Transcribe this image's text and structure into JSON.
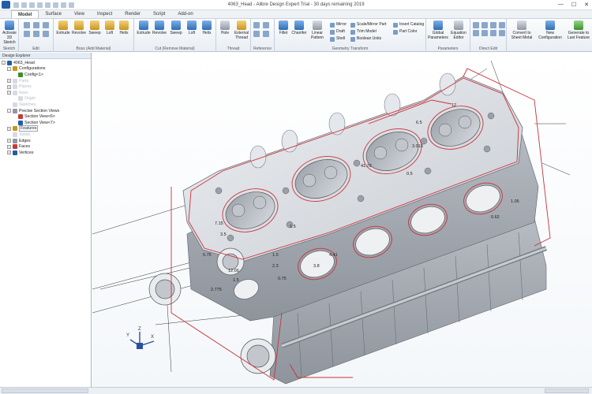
{
  "window": {
    "title": "4063_Head - Alibre Design Expert Trial - 30 days remaining 2019"
  },
  "tabs": [
    "Model",
    "Surface",
    "View",
    "Inspect",
    "Render",
    "Script",
    "Add-on"
  ],
  "ribbon": {
    "sketch": {
      "tool": "Activate 3D Sketch",
      "group": "Sketch"
    },
    "edit": {
      "group": "Edit"
    },
    "boss": {
      "group": "Boss (Add Material)",
      "tools": [
        "Extrude",
        "Revolve",
        "Sweep",
        "Loft",
        "Helix"
      ]
    },
    "cut": {
      "group": "Cut (Remove Material)",
      "tools": [
        "Extrude",
        "Revolve",
        "Sweep",
        "Loft",
        "Helix"
      ]
    },
    "thread": {
      "group": "Thread",
      "tools": [
        "Hole",
        "External Thread"
      ]
    },
    "reference": {
      "group": "Reference"
    },
    "geometry": {
      "group": "Geometry Transform",
      "tools": [
        "Fillet",
        "Chamfer",
        "Linear Pattern"
      ],
      "list1": [
        "Mirror",
        "Draft",
        "Shell"
      ],
      "list2": [
        "Scale/Mirror Part",
        "Trim Model",
        "Boolean Units"
      ],
      "list3": [
        "Insert Catalog",
        "Part Color"
      ]
    },
    "parameters": {
      "group": "Parameters",
      "tools": [
        "Global Parameters",
        "Equation Editor"
      ]
    },
    "direct_edit": {
      "group": "Direct Edit"
    },
    "other": {
      "tools": [
        "Convert to Sheet Metal",
        "New Configuration",
        "Generate to Last Feature"
      ]
    }
  },
  "explorer": {
    "title": "Design Explorer",
    "items": [
      {
        "label": "4063_Head",
        "level": 0,
        "expander": "-",
        "dim": false
      },
      {
        "label": "Configurations",
        "level": 1,
        "expander": "-",
        "dim": false
      },
      {
        "label": "Config<1>",
        "level": 2,
        "expander": "",
        "dim": false
      },
      {
        "label": "Parts",
        "level": 1,
        "expander": "+",
        "dim": true
      },
      {
        "label": "Planes",
        "level": 1,
        "expander": "+",
        "dim": true
      },
      {
        "label": "Axes",
        "level": 1,
        "expander": "+",
        "dim": true
      },
      {
        "label": "Origin",
        "level": 2,
        "expander": "",
        "dim": true
      },
      {
        "label": "Sketches",
        "level": 1,
        "expander": "",
        "dim": true
      },
      {
        "label": "Precise Section Views",
        "level": 1,
        "expander": "-",
        "dim": false
      },
      {
        "label": "Section View<6>",
        "level": 2,
        "expander": "",
        "dim": false
      },
      {
        "label": "Section View<7>",
        "level": 2,
        "expander": "",
        "dim": false
      },
      {
        "label": "Features",
        "level": 1,
        "expander": "+",
        "dim": false,
        "selected": true
      },
      {
        "label": "Solids",
        "level": 1,
        "expander": "",
        "dim": true
      },
      {
        "label": "Edges",
        "level": 1,
        "expander": "+",
        "dim": false
      },
      {
        "label": "Faces",
        "level": 1,
        "expander": "+",
        "dim": false
      },
      {
        "label": "Vertices",
        "level": 1,
        "expander": "+",
        "dim": false
      }
    ]
  },
  "dimensions": [
    "12",
    "6.5",
    "3.013",
    "41.78",
    "0.5",
    "7.15",
    "3.5",
    "5.75",
    "1.5",
    "12.06",
    "1.5",
    "2.775",
    "0.75",
    "1.0",
    "2.3",
    "3.8",
    "4.41",
    "0.62",
    "1.05"
  ],
  "triad": {
    "x": "X",
    "y": "Y",
    "z": "Z"
  },
  "colors": {
    "accent": "#1f5fa8",
    "section": "#c8323c",
    "model": "#d3d6da"
  }
}
